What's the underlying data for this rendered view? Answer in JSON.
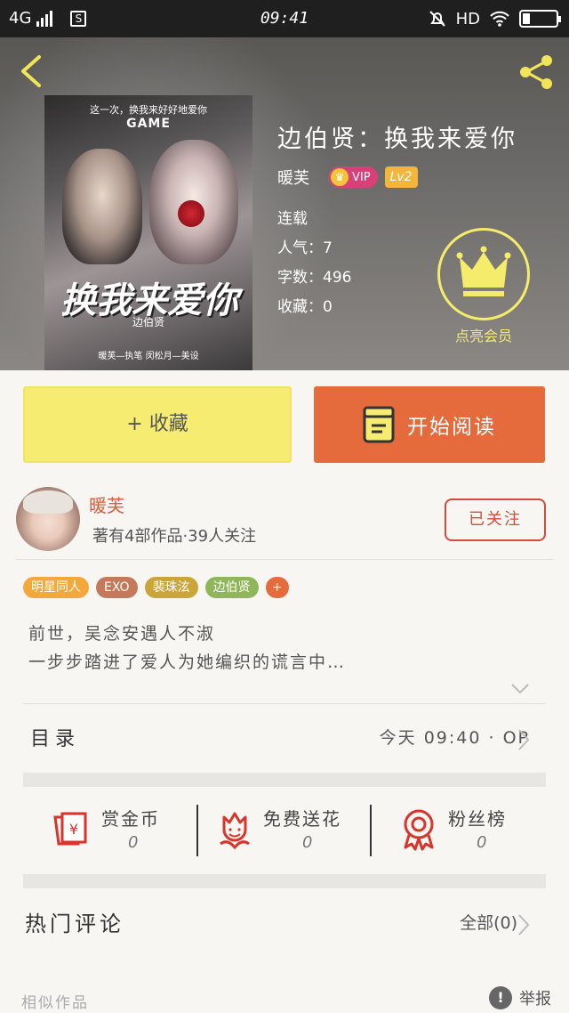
{
  "status_bar": {
    "network": "4G",
    "sim_label": "S",
    "time": "09:41",
    "hd_label": "HD"
  },
  "book": {
    "title": "边伯贤：换我来爱你",
    "author": "暖芙",
    "vip_label": "VIP",
    "level": "Lv2",
    "status": "连载",
    "popularity": "人气：7",
    "word_count": "字数：496",
    "favorites": "收藏：0",
    "member_label": "点亮会员"
  },
  "cover": {
    "tagline": "这一次，换我来好好地爱你",
    "game_text": "GAME",
    "big_title": "换我来爱你",
    "subtitle": "边伯贤",
    "credit": "暖芙—执笔  闵松月—美设"
  },
  "actions": {
    "favorite_label": "+ 收藏",
    "read_label": "开始阅读"
  },
  "author_card": {
    "name": "暖芙",
    "meta": "著有4部作品·39人关注",
    "follow_label": "已关注"
  },
  "tags": [
    {
      "label": "明星同人",
      "color": "#f2a83a"
    },
    {
      "label": "EXO",
      "color": "#c47a5a"
    },
    {
      "label": "裴珠泫",
      "color": "#c9a53a"
    },
    {
      "label": "边伯贤",
      "color": "#8fb65a"
    },
    {
      "label": "+",
      "color": "#e66b3c"
    }
  ],
  "synopsis": {
    "line1": "前世，吴念安遇人不淑",
    "line2": "一步步踏进了爱人为她编织的谎言中…"
  },
  "toc": {
    "label": "目录",
    "latest": "今天 09:40 · OP"
  },
  "stats": [
    {
      "label": "赏金币",
      "value": "0",
      "icon": "red-envelope-icon"
    },
    {
      "label": "免费送花",
      "value": "0",
      "icon": "flower-icon"
    },
    {
      "label": "粉丝榜",
      "value": "0",
      "icon": "award-ribbon-icon"
    }
  ],
  "comments": {
    "label": "热门评论",
    "all_label": "全部(0)"
  },
  "footer": {
    "similar_label": "相似作品",
    "report_label": "举报",
    "report_mark": "!"
  },
  "colors": {
    "accent_orange": "#e66b3c",
    "favorite_yellow": "#f7ec72",
    "member_yellow": "#f5ec6b",
    "icon_red": "#d9342b"
  }
}
